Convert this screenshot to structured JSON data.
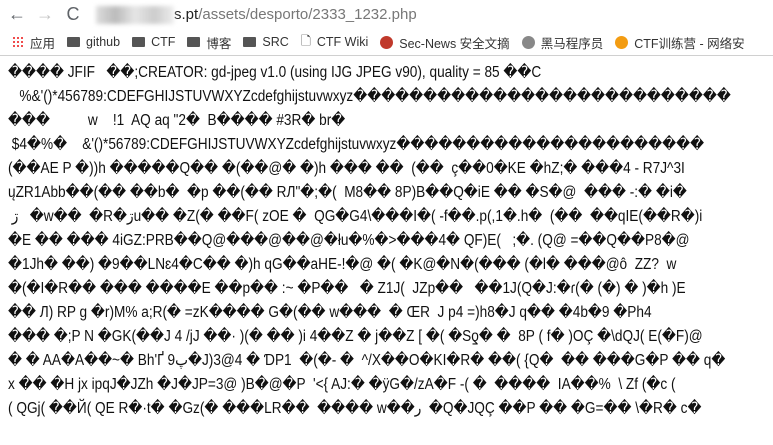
{
  "toolbar": {
    "back": "←",
    "forward": "→",
    "reload": "C",
    "url_host_suffix": "s.pt",
    "url_path": "/assets/desporto/2333_1232.php"
  },
  "bookmarks": [
    {
      "label": "应用",
      "icon": "apps-grid-icon"
    },
    {
      "label": "github",
      "icon": "folder-icon"
    },
    {
      "label": "CTF",
      "icon": "folder-icon"
    },
    {
      "label": "博客",
      "icon": "folder-icon"
    },
    {
      "label": "SRC",
      "icon": "folder-icon"
    },
    {
      "label": "CTF Wiki",
      "icon": "page-icon"
    },
    {
      "label": "Sec-News 安全文摘",
      "icon": "site-icon"
    },
    {
      "label": "黑马程序员",
      "icon": "site-icon"
    },
    {
      "label": "CTF训练营 - 网络安",
      "icon": "site-icon"
    }
  ],
  "content": [
    "���� JFIF   ��;CREATOR: gd-jpeg v1.0 (using IJG JPEG v90), quality = 85 ��C",
    "   %&'()*456789:CDEFGHIJSTUVWXYZcdefghijstuvwxyz���������������������������",
    "���          w    !1  AQ aq \"2�  B���� #3R� br�",
    " $4�%�    &'()*56789:CDEFGHIJSTUVWXYZcdefghijstuvwxyz����������������������",
    "(��AE P �))h �����Q�� �(��@� �)h ��� ��  (��  ç��0�KE �hZ;� ���4 - R7J^3I",
    "ųZR1Abb��(�� ��b�  �p ��(�� RЛ\"�;�(  M8�� 8P)B��Q�iE �� �S�@  ��� -:� �i�",
    " ڗ   �w��  �R�ڗu�� �Z(� ��F( zOE �  QG�G4\\���I�( -f��.p(,1�.h�  (��  ��qIE(��R�)i",
    "�E �� ��� 4iGZ:PRB��Q@���@��@�łu�%�>���4� QF)E(   ;�. (Q@ =��Q��P8�@",
    "�1Jh� ��) �9��LNɛ4�C�� �)h qG��aHE-!�@ �( �K@�N�(��� (�l� ���@ô  ZZ?  w",
    "�(�I�R�� ��� ����E ��p�� :~ �P��   � Z1J(  JZp��   ��1J(Q�J:�ɾ(� (�) � )�h )E",
    "�� Л) RP g �r)M% a;R(� =zK���� G�(�� w���  � ŒR  J p4 =)h8�J q�� �4b�9 �Ph4",
    "��� �;P N �GK(��J 4 /jJ ��· )(� �� )i 4��Z � j��Z [ �( �Sƍ� �  8P ( f� )OÇ �\\dQJ( E(�F)@",
    "� � AA�A��~� Bh'Ґ 9پ�J)3@4 � ƊP1  �(�- �  ^/X��O�KI�R� ��( {Q�  �� ���G�P �� q�",
    "x �� �H jx ipqJ�JZh �J�JP=3@ )B�@�P  '<{ AJ:� �ÿG�/zA�F -( �  ����  IA��%  \\ Zf (�c (",
    "( QGj( ��Й( QE R�·t� �Gz(� ���LR��  ���� w��ر  �Q�JQÇ ��P �� �G=�� \\�R� c�"
  ]
}
